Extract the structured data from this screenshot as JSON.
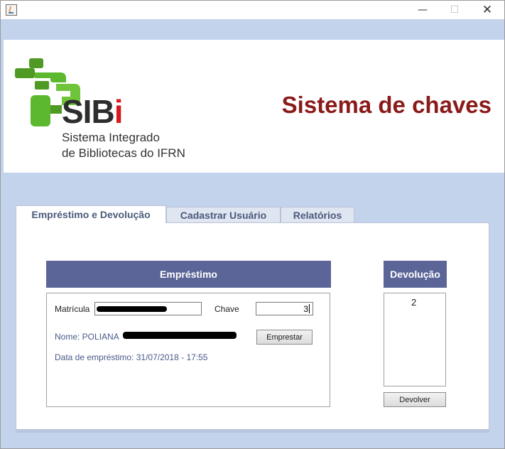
{
  "window": {
    "minimize_glyph": "—",
    "maximize_glyph": "☐",
    "close_glyph": "✕",
    "app_icon": "java-icon"
  },
  "header": {
    "logo_text": "SIBi",
    "logo_line1": "Sistema Integrado",
    "logo_line2": "de Bibliotecas do IFRN",
    "title": "Sistema de chaves",
    "colors": {
      "title": "#8b1a1a",
      "logo_green": "#5cb82e",
      "logo_red_i": "#d71920"
    }
  },
  "tabs": [
    {
      "label": "Empréstimo e Devolução",
      "active": true
    },
    {
      "label": "Cadastrar Usuário",
      "active": false
    },
    {
      "label": "Relatórios",
      "active": false
    }
  ],
  "emprestimo": {
    "header": "Empréstimo",
    "matricula_label": "Matrícula",
    "chave_label": "Chave",
    "chave_value": "3",
    "nome_text": "Nome: POLIANA",
    "data_text": "Data de empréstimo: 31/07/2018 - 17:55",
    "button_label": "Emprestar"
  },
  "devolucao": {
    "header": "Devolução",
    "items": [
      "2"
    ],
    "button_label": "Devolver"
  },
  "colors": {
    "section_header": "#5b6597",
    "background": "#c4d3ec"
  }
}
